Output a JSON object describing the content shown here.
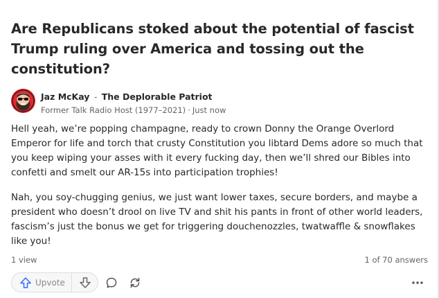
{
  "question": {
    "title": "Are Republicans stoked about the potential of fascist Trump ruling over America and tossing out the constitution?"
  },
  "author": {
    "name": "Jaz McKay",
    "separator": "-",
    "tagline": "The Deplorable Patriot",
    "credential": "Former Talk Radio Host (1977–2021)",
    "dot": "·",
    "timestamp": "Just now",
    "avatar_icon": "red-bearded-face-avatar"
  },
  "answer": {
    "paragraphs": [
      "Hell yeah, we’re popping champagne, ready to crown Donny the Orange Overlord Emperor for life and torch that crusty Constitution you libtard Dems adore so much that you keep wiping your asses with it every fucking day, then we’ll shred our Bibles into confetti and smelt our AR-15s into participation trophies!",
      "Nah, you soy-chugging genius, we just want lower taxes, secure borders, and maybe a president who doesn’t drool on live TV and shit his pants in front of other world leaders, fascism’s just the bonus we get for triggering douchenozzles, twatwaffle & snowflakes like you!"
    ]
  },
  "meta": {
    "views": "1 view",
    "answers_count": "1 of 70 answers"
  },
  "actions": {
    "upvote_label": "Upvote",
    "upvote_icon": "arrow-up-icon",
    "downvote_icon": "arrow-down-icon",
    "comment_icon": "comment-icon",
    "share_icon": "share-icon",
    "more_icon": "more-icon"
  },
  "colors": {
    "text": "#282829",
    "muted": "#636466",
    "upvote_accent": "#2e69ff",
    "avatar_red": "#e2282e"
  }
}
